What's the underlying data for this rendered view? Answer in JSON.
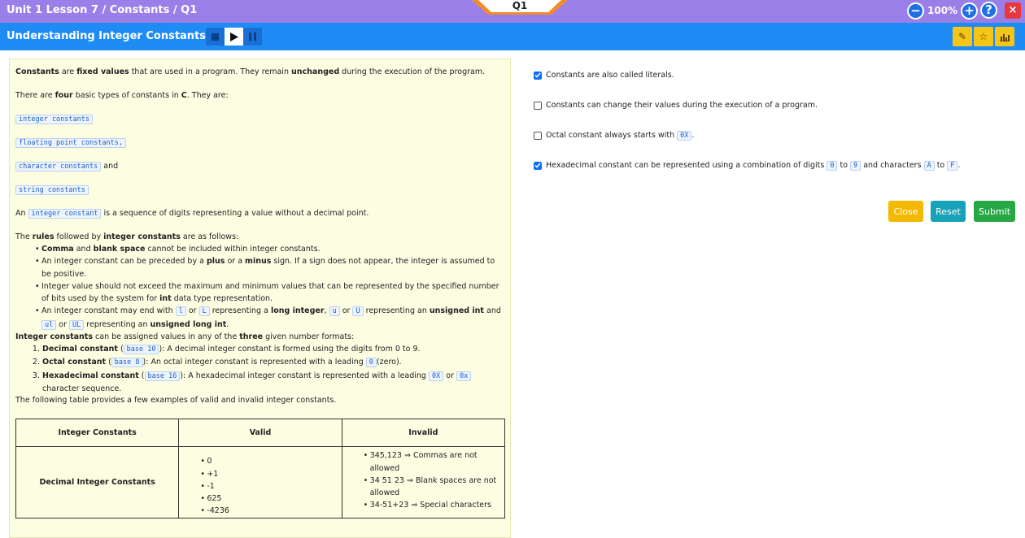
{
  "header": {
    "breadcrumb": "Unit 1 Lesson 7 / Constants / Q1",
    "question_tab": "Q1",
    "zoom": "100%",
    "minus": "−",
    "plus": "+",
    "help": "?",
    "close": "×"
  },
  "subheader": {
    "title": "Understanding Integer Constants"
  },
  "content": {
    "intro": {
      "a": "Constants",
      "b": " are ",
      "c": "fixed values",
      "d": " that are used in a program. They remain ",
      "e": "unchanged",
      "f": " during the execution of the program."
    },
    "types": {
      "a": "There are ",
      "b": "four",
      "c": " basic types of constants ",
      "d": "in",
      "e": "C",
      "f": ". They are:"
    },
    "type1": "integer constants",
    "type2": "floating point constants,",
    "type3": "character constants",
    "and": " and",
    "type4": "string constants",
    "def": {
      "a": "An ",
      "code": "integer constant",
      "b": " is a sequence of digits representing a value without a decimal point."
    },
    "rules_intro": {
      "a": "The ",
      "b": "rules",
      "c": " followed by ",
      "d": "integer constants",
      "e": " are as follows:"
    },
    "rule1": {
      "a": "Comma",
      "b": " and ",
      "c": "blank space",
      "d": " cannot be included within integer constants."
    },
    "rule2": {
      "a": "An integer constant can be preceded by a ",
      "b": "plus",
      "c": " or a ",
      "d": "minus",
      "e": " sign. If a sign does not appear, the integer is assumed to be positive."
    },
    "rule3": {
      "a": "Integer value should not exceed the maximum and minimum values that can be represented by the specified number of bits used by the system for ",
      "b": "int",
      "c": " data type representation."
    },
    "rule4": {
      "a": "An integer constant may end with ",
      "c1": "l",
      "or1": " or ",
      "c2": "L",
      "b": " representing a ",
      "b2": "long integer",
      "comma": ", ",
      "c3": "u",
      "or2": " or ",
      "c4": "U",
      "d": " representing an ",
      "d2": "unsigned int",
      "e": " and ",
      "c5": "ul",
      "or3": " or ",
      "c6": "UL",
      "f": " representing an ",
      "f2": "unsigned long int",
      "g": "."
    },
    "formats_intro": {
      "a": "Integer constants",
      "b": " can be assigned values in any of the ",
      "c": "three",
      "d": " given number formats:"
    },
    "fmt1": {
      "a": "Decimal constant",
      "b": " (",
      "c": "base 10",
      "d": "): A decimal integer constant is formed using the digits from 0 to 9."
    },
    "fmt2": {
      "a": "Octal constant",
      "b": " (",
      "c": "base 8",
      "d": "): An octal integer constant is represented with a leading ",
      "e": "0",
      "f": "(zero)."
    },
    "fmt3": {
      "a": "Hexadecimal constant",
      "b": " (",
      "c": "base 16",
      "d": "): A hexadecimal integer constant is represented with a leading ",
      "e": "0X",
      "or": " or ",
      "f": "0x",
      "g": " character sequence."
    },
    "table_intro": "The following table provides a few examples of valid and invalid integer constants.",
    "table": {
      "headers": [
        "Integer Constants",
        "Valid",
        "Invalid"
      ],
      "row1": {
        "label": "Decimal Integer Constants",
        "valid": [
          "0",
          "+1",
          "-1",
          "625",
          "-4236"
        ],
        "invalid": [
          "345,123 ⇒ Commas are not allowed",
          "34 51 23 ⇒ Blank spaces are not allowed",
          "34-51+23 ⇒ Special characters"
        ]
      }
    }
  },
  "options": {
    "opt1": {
      "text": "Constants are also called literals.",
      "checked": true
    },
    "opt2": {
      "text": "Constants can change their values during the execution of a program.",
      "checked": false
    },
    "opt3": {
      "a": "Octal constant always starts with ",
      "code": "0X",
      "b": ".",
      "checked": false
    },
    "opt4": {
      "a": "Hexadecimal constant can be represented using a combination of digits ",
      "c1": "0",
      "to1": " to ",
      "c2": "9",
      "b": " and characters ",
      "c3": "A",
      "to2": " to ",
      "c4": "F",
      "c": ".",
      "checked": true
    }
  },
  "buttons": {
    "close": "Close",
    "reset": "Reset",
    "submit": "Submit"
  },
  "colors": {
    "topbar": "#9b7fe8",
    "subbar": "#1f8cf5",
    "close": "#f5b800",
    "reset": "#17a2b8",
    "submit": "#28a745"
  }
}
